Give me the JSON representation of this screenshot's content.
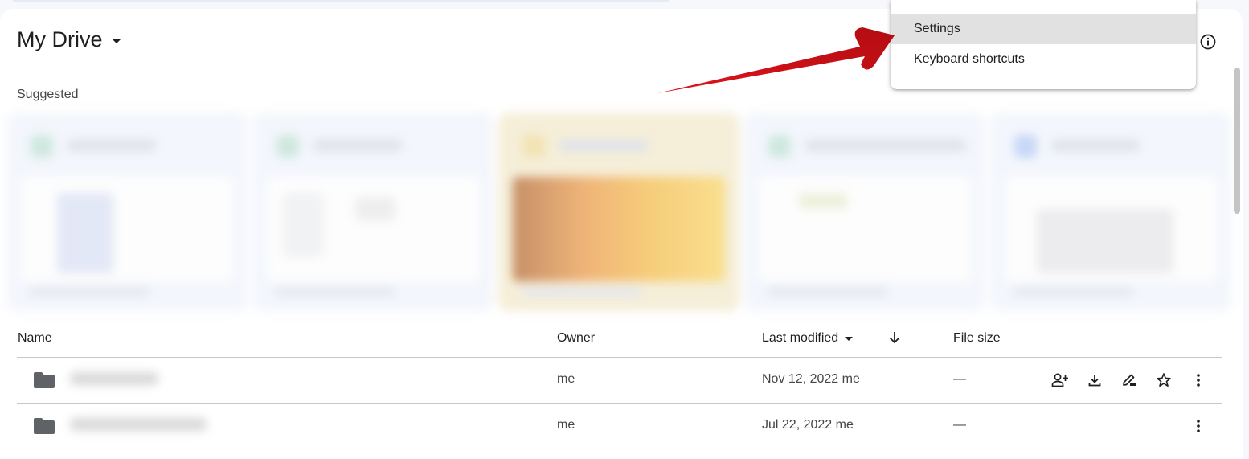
{
  "header": {
    "title": "My Drive",
    "info_icon": "info-icon"
  },
  "suggested": {
    "label": "Suggested",
    "cards": [
      {
        "type": "spreadsheet",
        "accent": "#cfe8df",
        "name": "(blurred)"
      },
      {
        "type": "spreadsheet",
        "accent": "#cfe8df",
        "name": "(blurred)"
      },
      {
        "type": "image",
        "accent": "#f6d27a",
        "name": "(blurred)"
      },
      {
        "type": "spreadsheet",
        "accent": "#cfe8df",
        "name": "(blurred)"
      },
      {
        "type": "document",
        "accent": "#c7d7f7",
        "name": "(blurred)"
      }
    ]
  },
  "table": {
    "columns": {
      "name": "Name",
      "owner": "Owner",
      "last_modified": "Last modified",
      "file_size": "File size"
    },
    "sort_direction_icon": "arrow-down-icon",
    "rows": [
      {
        "type": "folder",
        "name": "(blurred)",
        "owner": "me",
        "modified": "Nov 12, 2022 me",
        "size": "—",
        "hover_actions": [
          "share-icon",
          "download-icon",
          "rename-icon",
          "star-icon"
        ]
      },
      {
        "type": "folder",
        "name": "(blurred)",
        "owner": "me",
        "modified": "Jul 22, 2022 me",
        "size": "—",
        "hover_actions": []
      }
    ]
  },
  "menu": {
    "items": [
      {
        "label": "Settings",
        "highlighted": true
      },
      {
        "label": "Keyboard shortcuts",
        "highlighted": false
      }
    ]
  },
  "annotation": {
    "arrow_color": "#d0121a",
    "points_to": "Settings"
  }
}
